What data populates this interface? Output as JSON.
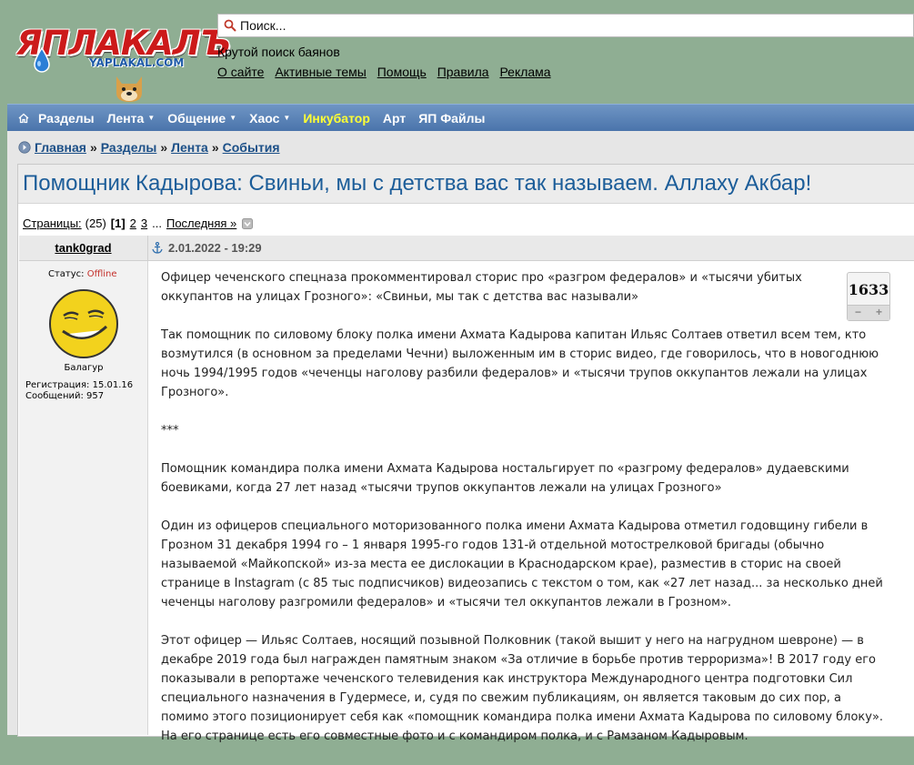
{
  "header": {
    "logo_text": "ЯПЛАКАЛЪ",
    "logo_sub": "YAPLAKAL.COM",
    "search_placeholder": "Поиск...",
    "tagline": "Крутой поиск баянов",
    "links": [
      "О сайте",
      "Активные темы",
      "Помощь",
      "Правила",
      "Реклама"
    ]
  },
  "nav": {
    "items": [
      {
        "label": "Разделы",
        "dropdown": false,
        "highlight": false
      },
      {
        "label": "Лента",
        "dropdown": true,
        "highlight": false
      },
      {
        "label": "Общение",
        "dropdown": true,
        "highlight": false
      },
      {
        "label": "Хаос",
        "dropdown": true,
        "highlight": false
      },
      {
        "label": "Инкубатор",
        "dropdown": false,
        "highlight": true
      },
      {
        "label": "Арт",
        "dropdown": false,
        "highlight": false
      },
      {
        "label": "ЯП Файлы",
        "dropdown": false,
        "highlight": false
      }
    ],
    "highlight_color": "#ffff33"
  },
  "breadcrumb": {
    "items": [
      "Главная",
      "Разделы",
      "Лента",
      "События"
    ],
    "separator": "»"
  },
  "topic": {
    "title": "Помощник Кадырова: Свиньи, мы с детства вас так называем. Аллаху Акбар!",
    "pages_label": "Страницы:",
    "pages_count": "(25)",
    "current_page": "[1]",
    "page_links": [
      "2",
      "3"
    ],
    "ellipsis": "...",
    "last_label": "Последняя »"
  },
  "post": {
    "author": "tank0grad",
    "date": "2.01.2022 - 19:29",
    "status_label": "Статус:",
    "status_value": "Offline",
    "rank": "Балагур",
    "registration": "Регистрация: 15.01.16",
    "messages": "Сообщений: 957",
    "rating": "1633",
    "rating_minus": "−",
    "rating_plus": "+",
    "paragraphs": [
      "Офицер чеченского спецназа прокомментировал сторис про «разгром федералов» и «тысячи убитых оккупантов на улицах Грозного»: «Свиньи, мы так с детства вас называли»",
      "Так помощник по силовому блоку полка имени Ахмата Кадырова капитан Ильяс Солтаев ответил всем тем, кто возмутился (в основном за пределами Чечни) выложенным им в сторис видео, где говорилось, что в новогоднюю ночь 1994/1995 годов «чеченцы наголову разбили федералов» и «тысячи трупов оккупантов лежали на улицах Грозного».",
      "***",
      "Помощник командира полка имени Ахмата Кадырова ностальгирует по «разгрому федералов» дудаевскими боевиками, когда 27 лет назад «тысячи трупов оккупантов лежали на улицах Грозного»",
      "Один из офицеров специального моторизованного полка имени Ахмата Кадырова отметил годовщину гибели в Грозном 31 декабря 1994 го – 1 января 1995-го годов 131-й отдельной мотострелковой бригады (обычно называемой «Майкопской» из-за места ее дислокации в Краснодарском крае), разместив в сторис на своей странице в Instagram (с 85 тыс подписчиков) видеозапись с текстом о том, как «27 лет назад... за несколько дней чеченцы наголову разгромили федералов» и «тысячи тел оккупантов лежали в Грозном».",
      "Этот офицер — Ильяс Солтаев, носящий позывной Полковник (такой вышит у него на нагрудном шевроне) — в декабре 2019 года был награжден памятным знаком «За отличие в борьбе против терроризма»! В 2017 году его показывали в репортаже чеченского телевидения как инструктора Международного центра подготовки Сил специального назначения в Гудермесе, и, судя по свежим публикациям, он является таковым до сих пор, а помимо этого позиционирует себя как «помощник командира полка имени Ахмата Кадырова по силовому блоку». На его странице есть его совместные фото и с командиром полка, и с Рамзаном Кадыровым."
    ]
  },
  "colors": {
    "background": "#8fae93",
    "nav_bar": "#5a82b8",
    "title": "#1c5d99",
    "link": "#1b4f87",
    "offline": "#c4302b"
  }
}
